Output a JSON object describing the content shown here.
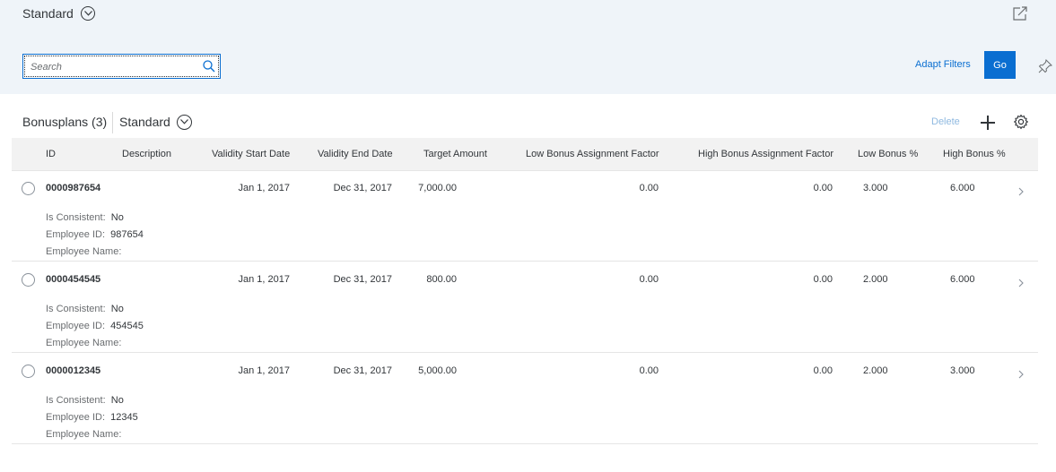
{
  "header": {
    "variant_title": "Standard",
    "search_placeholder": "Search",
    "adapt_filters_label": "Adapt Filters",
    "go_label": "Go"
  },
  "table": {
    "title": "Bonusplans (3)",
    "variant": "Standard",
    "delete_label": "Delete",
    "columns": {
      "id": "ID",
      "description": "Description",
      "validity_start": "Validity Start Date",
      "validity_end": "Validity End Date",
      "target_amount": "Target Amount",
      "low_factor": "Low Bonus Assignment Factor",
      "high_factor": "High Bonus Assignment Factor",
      "low_pct": "Low Bonus %",
      "high_pct": "High Bonus %"
    },
    "detail_labels": {
      "consistent": "Is Consistent:",
      "employee_id": "Employee ID:",
      "employee_name": "Employee Name:"
    },
    "rows": [
      {
        "id": "0000987654",
        "description": "",
        "start": "Jan 1, 2017",
        "end": "Dec 31, 2017",
        "target": "7,000.00",
        "low_factor": "0.00",
        "high_factor": "0.00",
        "low_pct": "3.000",
        "high_pct": "6.000",
        "is_consistent": "No",
        "employee_id": "987654",
        "employee_name": ""
      },
      {
        "id": "0000454545",
        "description": "",
        "start": "Jan 1, 2017",
        "end": "Dec 31, 2017",
        "target": "800.00",
        "low_factor": "0.00",
        "high_factor": "0.00",
        "low_pct": "2.000",
        "high_pct": "6.000",
        "is_consistent": "No",
        "employee_id": "454545",
        "employee_name": ""
      },
      {
        "id": "0000012345",
        "description": "",
        "start": "Jan 1, 2017",
        "end": "Dec 31, 2017",
        "target": "5,000.00",
        "low_factor": "0.00",
        "high_factor": "0.00",
        "low_pct": "2.000",
        "high_pct": "3.000",
        "is_consistent": "No",
        "employee_id": "12345",
        "employee_name": ""
      }
    ]
  },
  "icons": {
    "variant": "chevron-down-icon",
    "share": "share-icon",
    "search": "search-icon",
    "pin": "pin-icon",
    "add": "add-icon",
    "settings": "gear-icon",
    "row_nav": "chevron-right-icon"
  },
  "colors": {
    "header_bg": "#eff4f9",
    "accent": "#0a6ed1",
    "delete_disabled": "#8fb9e0"
  }
}
